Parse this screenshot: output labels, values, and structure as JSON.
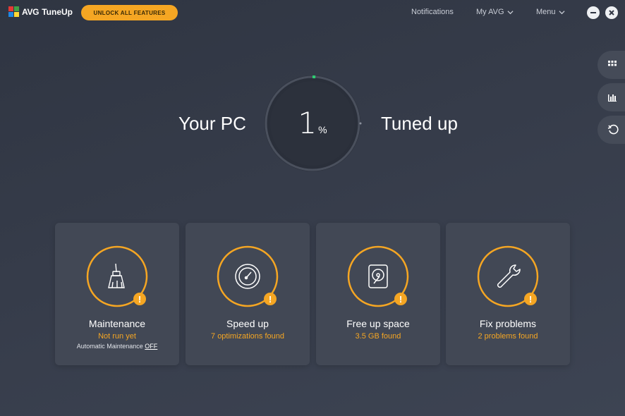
{
  "app": {
    "brand": "AVG",
    "product": "TuneUp",
    "unlock_label": "UNLOCK ALL FEATURES"
  },
  "nav": {
    "notifications": "Notifications",
    "my_avg": "My AVG",
    "menu": "Menu"
  },
  "hero": {
    "left_text": "Your PC",
    "right_text": "Tuned up",
    "percent_value": "1",
    "percent_unit": "%",
    "progress_fraction": 0.01
  },
  "side_panel": {
    "icons": [
      "apps-grid-icon",
      "stats-chart-icon",
      "undo-icon"
    ]
  },
  "cards": [
    {
      "title": "Maintenance",
      "status": "Not run yet",
      "note_prefix": "Automatic Maintenance ",
      "note_link": "OFF",
      "icon": "broom-icon"
    },
    {
      "title": "Speed up",
      "status": "7 optimizations found",
      "icon": "speedometer-icon"
    },
    {
      "title": "Free up space",
      "status": "3.5 GB found",
      "icon": "hard-disk-icon"
    },
    {
      "title": "Fix problems",
      "status": "2 problems found",
      "icon": "wrench-icon"
    }
  ],
  "colors": {
    "accent": "#f5a623",
    "background": "#363c4a",
    "card": "#424855",
    "progress": "#2ecc71"
  }
}
